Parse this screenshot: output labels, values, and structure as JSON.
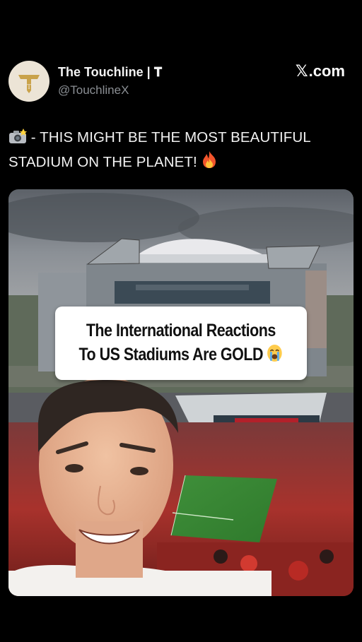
{
  "post": {
    "author_name": "The Touchline | 𝐓",
    "author_handle": "@TouchlineX",
    "avatar_letter": "T",
    "site_x": "𝕏",
    "site_domain": ".com",
    "caption_prefix": " - THIS MIGHT BE THE MOST BEAUTIFUL STADIUM ON THE PLANET!",
    "caption_icons": [
      "camera-flash-icon",
      "fire-icon"
    ]
  },
  "media": {
    "headline_line1": "The International Reactions",
    "headline_line2": "To US Stadiums Are GOLD",
    "headline_icon": "loudly-crying-face-icon"
  },
  "colors": {
    "background": "#000000",
    "handle": "#8b8f94",
    "avatar_bg": "#ece4d6",
    "avatar_gold": "#c9a24a"
  }
}
